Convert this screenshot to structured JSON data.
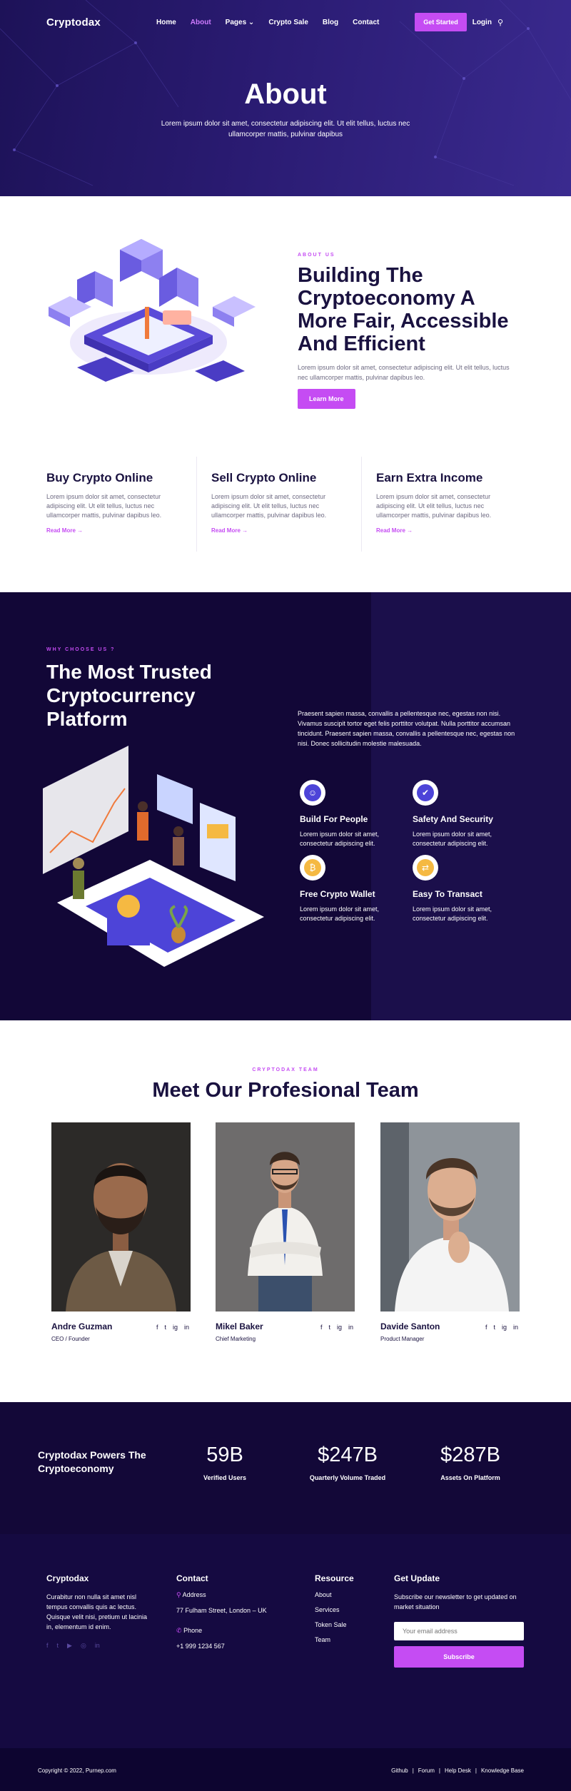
{
  "header": {
    "logo": "Cryptodax",
    "nav": [
      "Home",
      "About",
      "Pages",
      "Crypto Sale",
      "Blog",
      "Contact"
    ],
    "cta": "Get Started",
    "login": "Login",
    "title": "About",
    "subtitle": "Lorem ipsum dolor sit amet, consectetur adipiscing elit. Ut elit tellus, luctus nec ullamcorper mattis, pulvinar dapibus"
  },
  "about": {
    "eyebrow": "ABOUT US",
    "title": "Building The Cryptoeconomy A More Fair, Accessible And Efficient",
    "text": "Lorem ipsum dolor sit amet, consectetur adipiscing elit. Ut elit tellus, luctus nec ullamcorper mattis, pulvinar dapibus leo.",
    "button": "Learn More",
    "features": [
      {
        "title": "Buy Crypto Online",
        "text": "Lorem ipsum dolor sit amet, consectetur adipiscing elit. Ut elit tellus, luctus nec ullamcorper mattis, pulvinar dapibus leo.",
        "link": "Read More"
      },
      {
        "title": "Sell Crypto Online",
        "text": "Lorem ipsum dolor sit amet, consectetur adipiscing elit. Ut elit tellus, luctus nec ullamcorper mattis, pulvinar dapibus leo.",
        "link": "Read More"
      },
      {
        "title": "Earn Extra Income",
        "text": "Lorem ipsum dolor sit amet, consectetur adipiscing elit. Ut elit tellus, luctus nec ullamcorper mattis, pulvinar dapibus leo.",
        "link": "Read More"
      }
    ]
  },
  "why": {
    "eyebrow": "WHY CHOOSE US ?",
    "title": "The Most Trusted Cryptocurrency Platform",
    "intro": "Praesent sapien massa, convallis a pellentesque nec, egestas non nisi. Vivamus suscipit tortor eget felis porttitor volutpat. Nulla porttitor accumsan tincidunt. Praesent sapien massa, convallis a pellentesque nec, egestas non nisi. Donec sollicitudin molestie malesuada.",
    "features": [
      {
        "icon": "people-icon",
        "title": "Build For People",
        "text": "Lorem ipsum dolor sit amet, consectetur adipiscing elit."
      },
      {
        "icon": "shield-icon",
        "title": "Safety And Security",
        "text": "Lorem ipsum dolor sit amet, consectetur adipiscing elit."
      },
      {
        "icon": "wallet-icon",
        "title": "Free Crypto Wallet",
        "text": "Lorem ipsum dolor sit amet, consectetur adipiscing elit."
      },
      {
        "icon": "transact-icon",
        "title": "Easy To Transact",
        "text": "Lorem ipsum dolor sit amet, consectetur adipiscing elit."
      }
    ]
  },
  "team": {
    "eyebrow": "CRYPTODAX TEAM",
    "title": "Meet Our Profesional Team",
    "members": [
      {
        "name": "Andre Guzman",
        "role": "CEO / Founder"
      },
      {
        "name": "Mikel Baker",
        "role": "Chief Marketing"
      },
      {
        "name": "Davide Santon",
        "role": "Product Manager"
      }
    ],
    "socials": [
      "f",
      "t",
      "ig",
      "in"
    ]
  },
  "stats": {
    "title": "Cryptodax Powers The Cryptoeconomy",
    "items": [
      {
        "value": "59B",
        "label": "Verified Users"
      },
      {
        "value": "$247B",
        "label": "Quarterly Volume Traded"
      },
      {
        "value": "$287B",
        "label": "Assets On Platform"
      }
    ]
  },
  "footer": {
    "brand": "Cryptodax",
    "brand_text": "Curabitur non nulla sit amet nisl tempus convallis quis ac lectus. Quisque velit nisi, pretium ut lacinia in, elementum id enim.",
    "contact_title": "Contact",
    "address_label": "Address",
    "address": "77 Fulham Street, London – UK",
    "phone_label": "Phone",
    "phone": "+1 999 1234 567",
    "resource_title": "Resource",
    "resources": [
      "About",
      "Services",
      "Token Sale",
      "Team"
    ],
    "update_title": "Get Update",
    "update_text": "Subscribe our newsletter to get updated on market situation",
    "email_placeholder": "Your email address",
    "subscribe": "Subscribe",
    "copyright": "Copyright © 2022, Purnep.com",
    "bottom_links": [
      "Github",
      "Forum",
      "Help Desk",
      "Knowledge Base"
    ]
  },
  "colors": {
    "accent": "#c54cf3",
    "dark": "#120737",
    "heading": "#1a1240"
  }
}
